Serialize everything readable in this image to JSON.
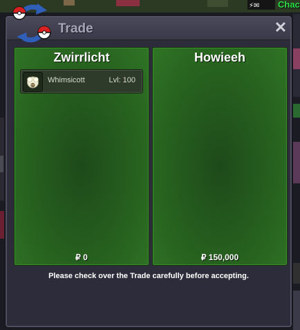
{
  "window": {
    "title": "Trade",
    "close_glyph": "✕",
    "logo_icon": "trade-swap-icon"
  },
  "left_trader": {
    "name": "Zwirrlicht",
    "money": "₽ 0",
    "items": [
      {
        "name": "Whimsicott",
        "level": "Lvl: 100",
        "icon": "whimsicott-icon"
      }
    ]
  },
  "right_trader": {
    "name": "Howieeh",
    "money": "₽ 150,000",
    "items": []
  },
  "notice": "Please check over the Trade carefully before accepting.",
  "background": {
    "chat_label": "Chac"
  },
  "colors": {
    "panel_green": "#27621f",
    "window_bg": "#2d2c3a",
    "chat_green": "#2ee04a"
  }
}
